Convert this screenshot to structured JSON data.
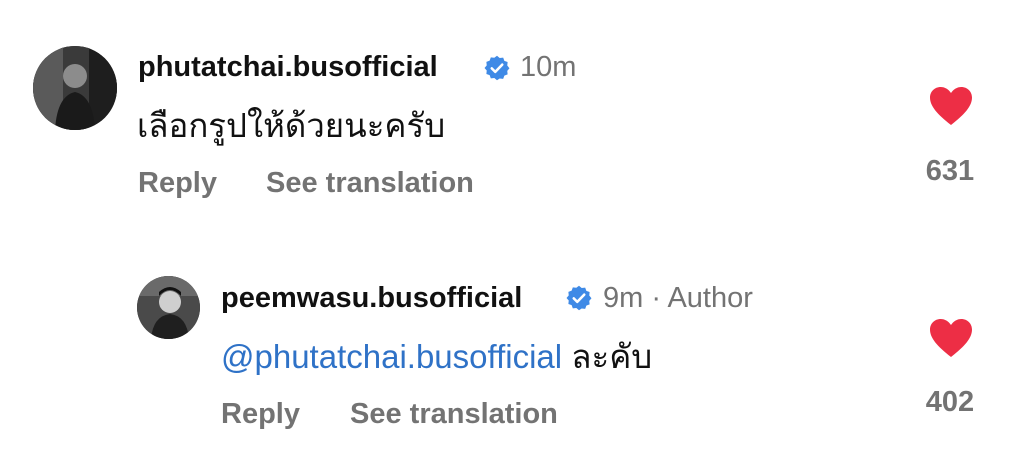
{
  "comments": [
    {
      "username": "phutatchai.busofficial",
      "verified": true,
      "time": "10m",
      "text": "เลือกรูปให้ด้วยนะครับ",
      "reply_label": "Reply",
      "translate_label": "See translation",
      "like_count": "631",
      "liked": true
    },
    {
      "username": "peemwasu.busofficial",
      "verified": true,
      "meta": "9m · Author",
      "mention": "@phutatchai.busofficial",
      "text": " ละคับ",
      "reply_label": "Reply",
      "translate_label": "See translation",
      "like_count": "402",
      "liked": true
    }
  ],
  "colors": {
    "like_red": "#ed2e45",
    "verified_blue": "#3f8ae6",
    "mention_blue": "#2f72c7",
    "meta_gray": "#737373"
  },
  "icons": [
    "avatar",
    "verified-badge-icon",
    "heart-icon"
  ]
}
